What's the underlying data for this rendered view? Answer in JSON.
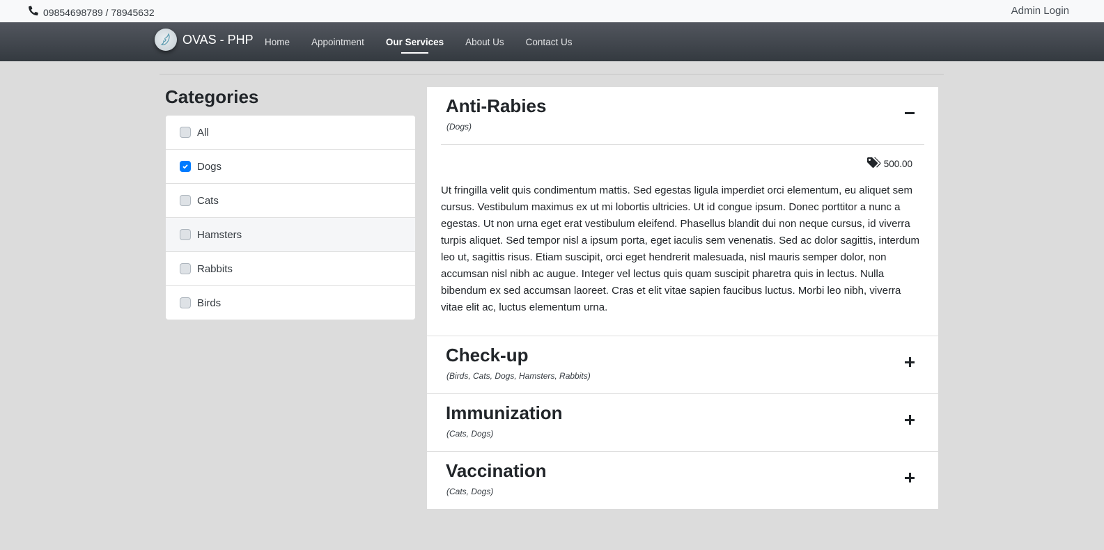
{
  "topbar": {
    "phone_icon": "phone-icon",
    "phone": "09854698789 / 78945632",
    "admin_login": "Admin Login"
  },
  "navbar": {
    "brand": "OVAS - PHP",
    "logo_icon": "dog-logo",
    "links": [
      {
        "label": "Home",
        "active": false
      },
      {
        "label": "Appointment",
        "active": false
      },
      {
        "label": "Our Services",
        "active": true
      },
      {
        "label": "About Us",
        "active": false
      },
      {
        "label": "Contact Us",
        "active": false
      }
    ]
  },
  "sidebar": {
    "title": "Categories",
    "categories": [
      {
        "label": "All",
        "checked": false
      },
      {
        "label": "Dogs",
        "checked": true
      },
      {
        "label": "Cats",
        "checked": false
      },
      {
        "label": "Hamsters",
        "checked": false
      },
      {
        "label": "Rabbits",
        "checked": false
      },
      {
        "label": "Birds",
        "checked": false
      }
    ]
  },
  "services": [
    {
      "title": "Anti-Rabies",
      "tags": "(Dogs)",
      "expanded": true,
      "toggle_icon": "minus-icon",
      "price_icon": "tags-icon",
      "price": "500.00",
      "description": "Ut fringilla velit quis condimentum mattis. Sed egestas ligula imperdiet orci elementum, eu aliquet sem cursus. Vestibulum maximus ex ut mi lobortis ultricies. Ut id congue ipsum. Donec porttitor a nunc a egestas. Ut non urna eget erat vestibulum eleifend. Phasellus blandit dui non neque cursus, id viverra turpis aliquet. Sed tempor nisl a ipsum porta, eget iaculis sem venenatis. Sed ac dolor sagittis, interdum leo ut, sagittis risus. Etiam suscipit, orci eget hendrerit malesuada, nisl mauris semper dolor, non accumsan nisl nibh ac augue. Integer vel lectus quis quam suscipit pharetra quis in lectus. Nulla bibendum ex sed accumsan laoreet. Cras et elit vitae sapien faucibus luctus. Morbi leo nibh, viverra vitae elit ac, luctus elementum urna."
    },
    {
      "title": "Check-up",
      "tags": "(Birds, Cats, Dogs, Hamsters, Rabbits)",
      "expanded": false,
      "toggle_icon": "plus-icon"
    },
    {
      "title": "Immunization",
      "tags": "(Cats, Dogs)",
      "expanded": false,
      "toggle_icon": "plus-icon"
    },
    {
      "title": "Vaccination",
      "tags": "(Cats, Dogs)",
      "expanded": false,
      "toggle_icon": "plus-icon"
    }
  ]
}
